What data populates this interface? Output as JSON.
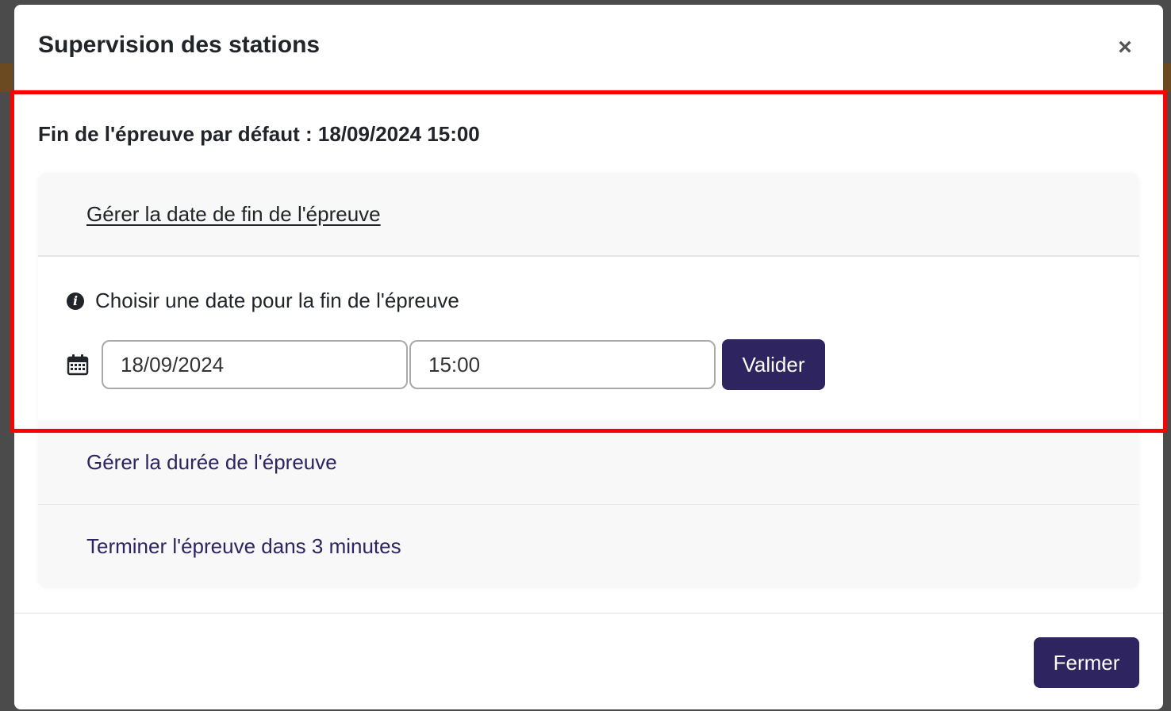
{
  "modal": {
    "title": "Supervision des stations",
    "close_symbol": "×"
  },
  "body": {
    "default_end_text": "Fin de l'épreuve par défaut : 18/09/2024 15:00"
  },
  "accordion": {
    "items": [
      {
        "label": "Gérer la date de fin de l'épreuve",
        "expanded": true
      },
      {
        "label": "Gérer la durée de l'épreuve",
        "expanded": false
      },
      {
        "label": "Terminer l'épreuve dans 3 minutes",
        "expanded": false
      }
    ],
    "date_panel": {
      "info_text": "Choisir une date pour la fin de l'épreuve",
      "info_icon": "info-circle-icon",
      "calendar_icon": "calendar-icon",
      "date_value": "18/09/2024",
      "time_value": "15:00",
      "submit_label": "Valider"
    }
  },
  "footer": {
    "close_label": "Fermer"
  },
  "colors": {
    "primary": "#2d2460",
    "highlight": "#ff0000",
    "accordion_bg": "#f8f8f9"
  }
}
